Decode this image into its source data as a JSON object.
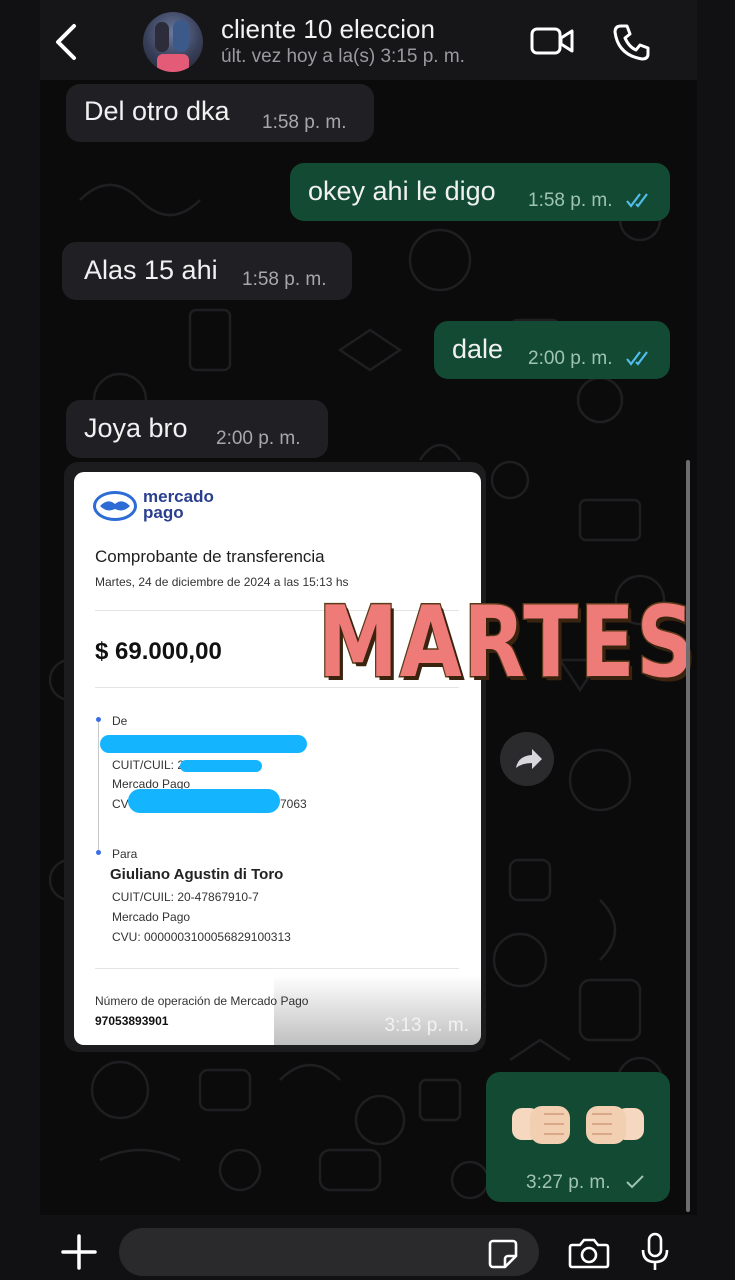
{
  "header": {
    "contact_name": "cliente 10 eleccion",
    "last_seen": "últ. vez hoy a la(s) 3:15 p. m.",
    "icons": [
      "back-arrow-icon",
      "video-call-icon",
      "phone-call-icon"
    ]
  },
  "messages": [
    {
      "direction": "incoming",
      "text": "Del otro dka",
      "time": "1:58 p. m."
    },
    {
      "direction": "outgoing",
      "text": "okey ahi le digo",
      "time": "1:58 p. m.",
      "status": "read"
    },
    {
      "direction": "incoming",
      "text": "Alas 15 ahi",
      "time": "1:58 p. m."
    },
    {
      "direction": "outgoing",
      "text": "dale",
      "time": "2:00 p. m.",
      "status": "read"
    },
    {
      "direction": "incoming",
      "text": "Joya bro",
      "time": "2:00 p. m."
    }
  ],
  "receipt": {
    "brand_line1": "mercado",
    "brand_line2": "pago",
    "title": "Comprobante de transferencia",
    "date": "Martes, 24 de diciembre de 2024 a las 15:13 hs",
    "amount": "$ 69.000,00",
    "from_label": "De",
    "from_cuit_prefix": "CUIT/CUIL: 20-4",
    "from_bank": "Mercado Pago",
    "from_cvu_prefix": "CV",
    "from_cvu_suffix": "7063",
    "to_label": "Para",
    "to_name": "Giuliano Agustin di Toro",
    "to_cuit": "CUIT/CUIL: 20-47867910-7",
    "to_bank": "Mercado Pago",
    "to_cvu": "CVU: 0000003100056829100313",
    "op_label": "Número de operación de Mercado Pago",
    "op_number": "97053893901",
    "time": "3:13 p. m."
  },
  "overlay_text": "MARTES",
  "last_message": {
    "direction": "outgoing",
    "emoji": "fist-bump",
    "time": "3:27 p. m.",
    "status": "sent"
  },
  "composer": {
    "placeholder": ""
  },
  "colors": {
    "incoming_bubble": "#202024",
    "outgoing_bubble": "#124a33",
    "read_tick": "#53bdeb",
    "overlay": "#ef7b78"
  }
}
